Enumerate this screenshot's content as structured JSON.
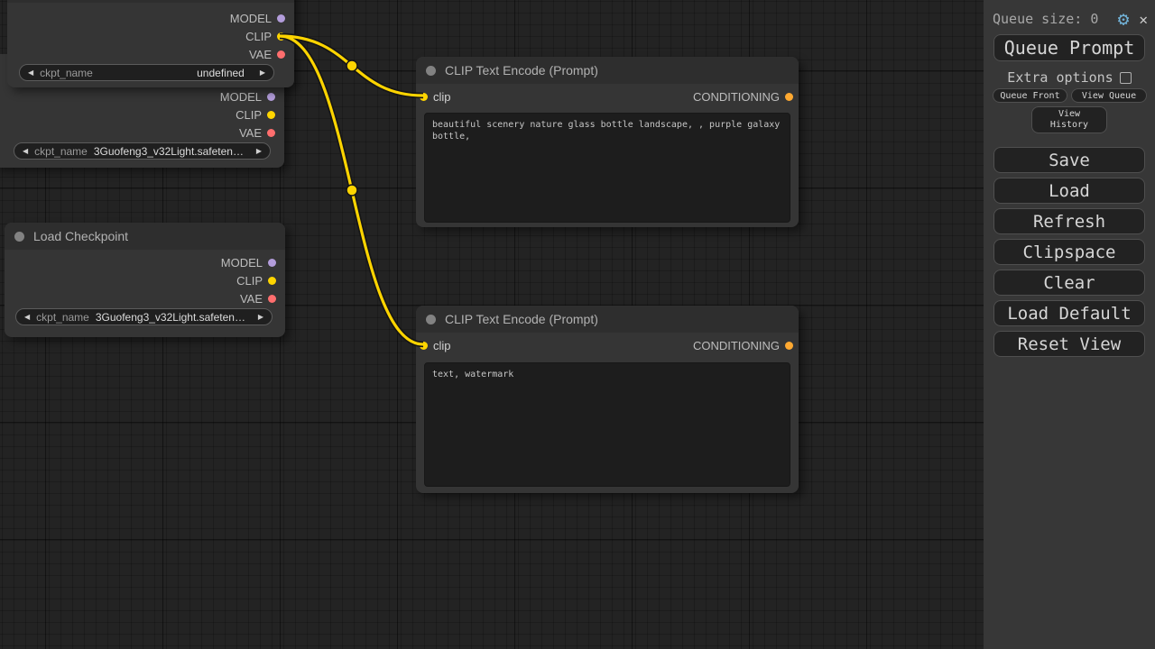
{
  "glyphs": {
    "left_arrow": "◀",
    "right_arrow": "▶",
    "settings": "⚙",
    "close": "✕"
  },
  "colors": {
    "model_slot": "#b39ddb",
    "clip_slot": "#ffd500",
    "vae_slot": "#ff6e6e",
    "conditioning_slot": "#ffa931",
    "wire": "#fdd400",
    "settings_icon": "#71b1d6",
    "node_bg": "#353535",
    "canvas_bg": "#232323"
  },
  "nodes": {
    "ckpt_top": {
      "outputs": [
        "MODEL",
        "CLIP",
        "VAE"
      ],
      "widget": {
        "label": "ckpt_name",
        "value": "undefined"
      }
    },
    "ckpt_mid": {
      "outputs": [
        "MODEL",
        "CLIP",
        "VAE"
      ],
      "widget": {
        "label": "ckpt_name",
        "value": "3Guofeng3_v32Light.safeten…"
      }
    },
    "load_checkpoint": {
      "title": "Load Checkpoint",
      "outputs": [
        "MODEL",
        "CLIP",
        "VAE"
      ],
      "widget": {
        "label": "ckpt_name",
        "value": "3Guofeng3_v32Light.safeten…"
      }
    },
    "clip_encode_pos": {
      "title": "CLIP Text Encode (Prompt)",
      "input": "clip",
      "output": "CONDITIONING",
      "text": "beautiful scenery nature glass bottle landscape, , purple galaxy bottle,"
    },
    "clip_encode_neg": {
      "title": "CLIP Text Encode (Prompt)",
      "input": "clip",
      "output": "CONDITIONING",
      "text": "text, watermark"
    }
  },
  "links": [
    {
      "from": "checkpoint CLIP output",
      "to": "clip input of upper CLIP Text Encode"
    },
    {
      "from": "checkpoint CLIP output",
      "to": "clip input of lower CLIP Text Encode"
    }
  ],
  "sidebar": {
    "queue_size": "Queue size: 0",
    "queue_prompt": "Queue Prompt",
    "extra_options": "Extra options",
    "queue_front": "Queue Front",
    "view_queue": "View Queue",
    "view_history": "View History",
    "buttons": [
      "Save",
      "Load",
      "Refresh",
      "Clipspace",
      "Clear",
      "Load Default",
      "Reset View"
    ]
  }
}
